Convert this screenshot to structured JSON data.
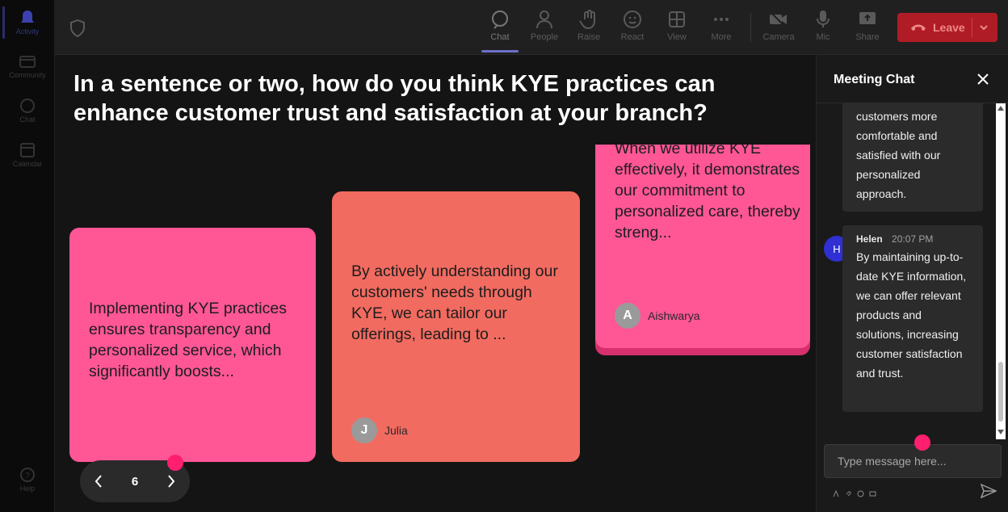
{
  "rail": {
    "items": [
      {
        "label": "Activity",
        "icon": "bell-icon"
      },
      {
        "label": "Community",
        "icon": "community-icon"
      },
      {
        "label": "Chat",
        "icon": "chat-icon"
      },
      {
        "label": "Calendar",
        "icon": "calendar-icon"
      },
      {
        "label": "Help",
        "icon": "help-icon"
      }
    ]
  },
  "toolbar": {
    "chat": "Chat",
    "people": "People",
    "raise": "Raise",
    "react": "React",
    "view": "View",
    "more": "More",
    "camera": "Camera",
    "mic": "Mic",
    "share": "Share",
    "leave": "Leave"
  },
  "stage": {
    "question": "In a sentence or two, how do you think KYE practices can enhance customer trust and satisfaction at your branch?",
    "cards": [
      {
        "text": "Implementing KYE practices ensures transparency and personalized service, which significantly boosts...",
        "author": "",
        "initial": ""
      },
      {
        "text": "By actively understanding our customers' needs through KYE, we can tailor our offerings, leading to ...",
        "author": "Julia",
        "initial": "J"
      },
      {
        "text": "When we utilize KYE effectively, it demonstrates our commitment to personalized care, thereby streng...",
        "author": "Aishwarya",
        "initial": "A"
      }
    ],
    "page": "6"
  },
  "chat": {
    "title": "Meeting Chat",
    "messages": [
      {
        "author": "",
        "time": "",
        "text": "customers more comfortable and satisfied with our personalized approach."
      },
      {
        "author": "Helen",
        "initial": "H",
        "time": "20:07 PM",
        "text": "By maintaining up-to-date KYE information, we can offer relevant products and solutions, increasing customer satisfaction and trust."
      }
    ],
    "composer_placeholder": "Type message here..."
  },
  "colors": {
    "card_pink": "#ff5696",
    "card_coral": "#f26b60",
    "leave_red": "#b01c26",
    "accent_dot": "#ff1f6e",
    "avatar_blue": "#2f2fd4"
  }
}
